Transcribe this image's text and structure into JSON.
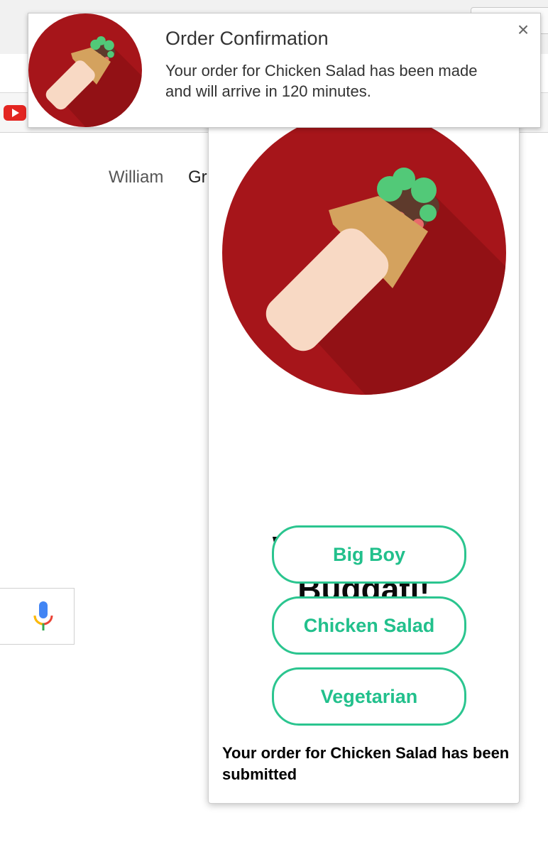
{
  "background": {
    "header_links": [
      "William",
      "Gr"
    ]
  },
  "notification": {
    "title": "Order Confirmation",
    "body": "Your order for Chicken Salad has been made and will arrive in 120 minutes.",
    "close_symbol": "×",
    "icon": "burrito-logo-icon"
  },
  "popup": {
    "title_line1": "Welcome to",
    "title_line2": "Buggati!",
    "buttons": [
      "Big Boy",
      "Chicken Salad",
      "Vegetarian"
    ],
    "status": "Your order for Chicken Salad has been submitted",
    "logo": "burrito-logo-icon"
  },
  "colors": {
    "brand_red": "#a6151a",
    "accent_green": "#2bc58f"
  }
}
